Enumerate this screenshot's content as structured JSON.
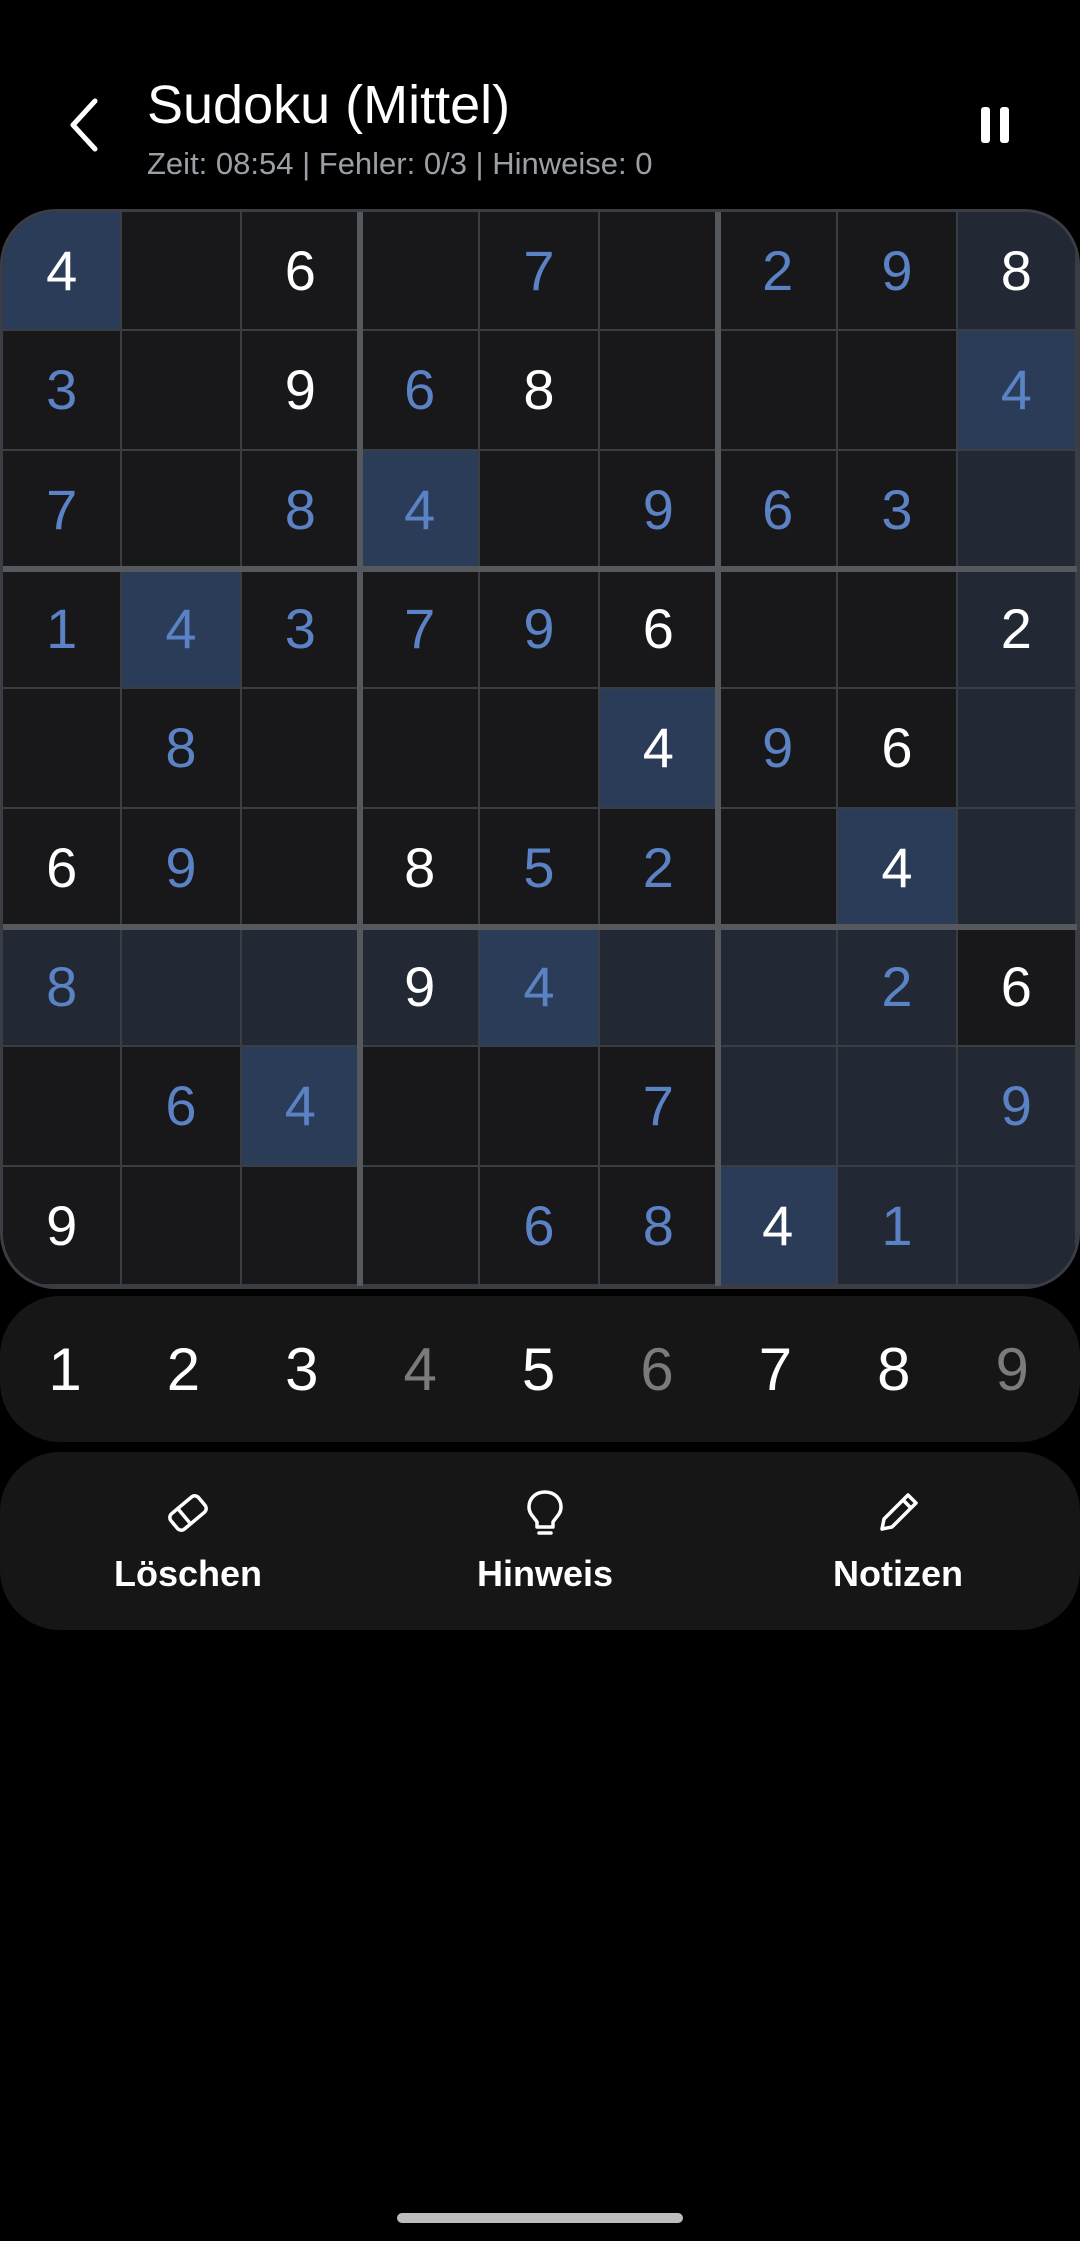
{
  "header": {
    "title": "Sudoku (Mittel)",
    "status": "Zeit: 08:54 | Fehler: 0/3 | Hinweise: 0"
  },
  "board": {
    "rows": [
      [
        "4",
        "",
        "6",
        "",
        "7",
        "",
        "2",
        "9",
        "8"
      ],
      [
        "3",
        "",
        "9",
        "6",
        "8",
        "",
        "",
        "",
        "4"
      ],
      [
        "7",
        "",
        "8",
        "4",
        "",
        "9",
        "6",
        "3",
        ""
      ],
      [
        "1",
        "4",
        "3",
        "7",
        "9",
        "6",
        "",
        "",
        "2"
      ],
      [
        "",
        "8",
        "",
        "",
        "",
        "4",
        "9",
        "6",
        ""
      ],
      [
        "6",
        "9",
        "",
        "8",
        "5",
        "2",
        "",
        "4",
        ""
      ],
      [
        "8",
        "",
        "",
        "9",
        "4",
        "",
        "",
        "2",
        "6"
      ],
      [
        "",
        "6",
        "4",
        "",
        "",
        "7",
        "",
        "",
        "9"
      ],
      [
        "9",
        "",
        "",
        "",
        "6",
        "8",
        "4",
        "1",
        ""
      ]
    ],
    "kinds": [
      [
        "g",
        "",
        "g",
        "",
        "u",
        "",
        "u",
        "u",
        "g"
      ],
      [
        "u",
        "",
        "g",
        "u",
        "g",
        "",
        "",
        "",
        "u"
      ],
      [
        "u",
        "",
        "u",
        "u",
        "",
        "u",
        "u",
        "u",
        ""
      ],
      [
        "u",
        "u",
        "u",
        "u",
        "u",
        "g",
        "",
        "",
        "g"
      ],
      [
        "",
        "u",
        "",
        "",
        "",
        "g",
        "u",
        "g",
        ""
      ],
      [
        "g",
        "u",
        "",
        "g",
        "u",
        "u",
        "",
        "g",
        ""
      ],
      [
        "u",
        "",
        "",
        "g",
        "u",
        "",
        "",
        "u",
        "g"
      ],
      [
        "",
        "u",
        "u",
        "",
        "",
        "u",
        "",
        "",
        "u"
      ],
      [
        "g",
        "",
        "",
        "",
        "u",
        "u",
        "g",
        "u",
        ""
      ]
    ],
    "selected_cell": {
      "row": 6,
      "col": 8
    },
    "highlight_value": "4",
    "colors": {
      "given": "#ffffff",
      "user": "#5b82c4",
      "selected": "#3e5a85",
      "same_value": "#2a3c58",
      "related": "#222834",
      "plain": "#18181b"
    }
  },
  "numpad": [
    {
      "label": "1",
      "state": "active"
    },
    {
      "label": "2",
      "state": "active"
    },
    {
      "label": "3",
      "state": "active"
    },
    {
      "label": "4",
      "state": "done"
    },
    {
      "label": "5",
      "state": "active"
    },
    {
      "label": "6",
      "state": "done"
    },
    {
      "label": "7",
      "state": "active"
    },
    {
      "label": "8",
      "state": "active"
    },
    {
      "label": "9",
      "state": "done"
    }
  ],
  "actions": [
    {
      "label": "Löschen",
      "icon": "eraser-icon"
    },
    {
      "label": "Hinweis",
      "icon": "lightbulb-icon"
    },
    {
      "label": "Notizen",
      "icon": "pencil-icon"
    }
  ]
}
